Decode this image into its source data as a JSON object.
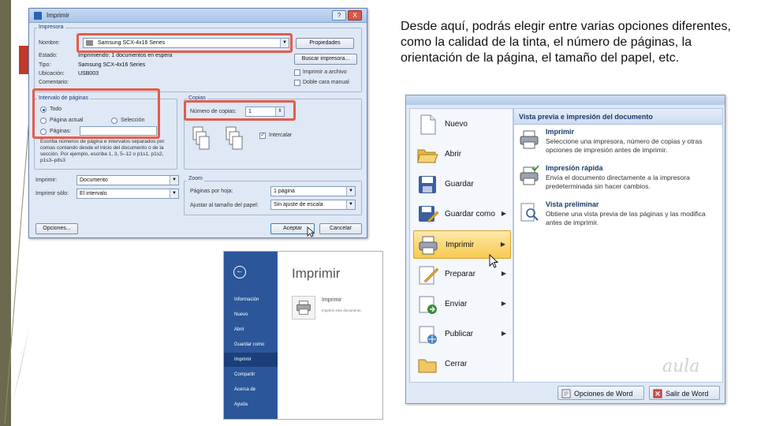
{
  "instruction_text": "Desde aquí, podrás elegir entre varias opciones diferentes, como la calidad de la tinta, el número de páginas, la orientación de la página, el tamaño del papel, etc.",
  "print_dialog": {
    "title": "Imprimir",
    "help_label": "?",
    "close_label": "X",
    "printer_group_title": "Impresora",
    "name_label": "Nombre:",
    "name_value": "Samsung SCX-4x16 Series",
    "properties_button": "Propiedades",
    "status_label": "Estado:",
    "status_value": "Imprimiendo: 1 documentos en espera",
    "find_printer_button": "Buscar impresora...",
    "type_label": "Tipo:",
    "type_value": "Samsung SCX-4x16 Series",
    "location_label": "Ubicación:",
    "location_value": "USB003",
    "comment_label": "Comentario:",
    "print_to_file_label": "Imprimir a archivo",
    "manual_duplex_label": "Doble cara manual",
    "page_range_title": "Intervalo de páginas",
    "all_label": "Todo",
    "current_page_label": "Página actual",
    "selection_label": "Selección",
    "pages_label": "Páginas:",
    "help_text": "Escriba números de página e intervalos separados por comas contando desde el inicio del documento o de la sección. Por ejemplo, escriba 1, 3, 5–12 o p1s1, p1s2, p1s3–p8s3",
    "copies_title": "Copias",
    "copies_label": "Número de copias:",
    "copies_value": "1",
    "collate_label": "Intercalar",
    "collate_checked": true,
    "print_label": "Imprimir:",
    "print_value": "Documento",
    "print_only_label": "Imprimir sólo:",
    "print_only_value": "El intervalo",
    "zoom_title": "Zoom",
    "pages_per_sheet_label": "Páginas por hoja:",
    "pages_per_sheet_value": "1 página",
    "scale_label": "Ajustar al tamaño del papel:",
    "scale_value": "Sin ajuste de escala",
    "options_button": "Opciones...",
    "ok_button": "Aceptar",
    "cancel_button": "Cancelar"
  },
  "office_menu": {
    "left_items": [
      {
        "label": "Nuevo",
        "icon": "new-document-icon",
        "has_arrow": false
      },
      {
        "label": "Abrir",
        "icon": "open-folder-icon",
        "has_arrow": false
      },
      {
        "label": "Guardar",
        "icon": "save-disk-icon",
        "has_arrow": false
      },
      {
        "label": "Guardar como",
        "icon": "save-as-icon",
        "has_arrow": true
      },
      {
        "label": "Imprimir",
        "icon": "printer-icon",
        "has_arrow": true
      },
      {
        "label": "Preparar",
        "icon": "prepare-icon",
        "has_arrow": true
      },
      {
        "label": "Enviar",
        "icon": "send-icon",
        "has_arrow": true
      },
      {
        "label": "Publicar",
        "icon": "publish-icon",
        "has_arrow": true
      },
      {
        "label": "Cerrar",
        "icon": "close-folder-icon",
        "has_arrow": false
      }
    ],
    "right_title": "Vista previa e impresión del documento",
    "right_items": [
      {
        "title": "Imprimir",
        "desc": "Seleccione una impresora, número de copias y otras opciones de impresión antes de imprimir.",
        "icon": "printer-icon"
      },
      {
        "title": "Impresión rápida",
        "desc": "Envía el documento directamente a la impresora predeterminada sin hacer cambios.",
        "icon": "quick-print-icon"
      },
      {
        "title": "Vista preliminar",
        "desc": "Obtiene una vista previa de las páginas y las modifica antes de imprimir.",
        "icon": "print-preview-icon"
      }
    ],
    "options_button": "Opciones de Word",
    "exit_button": "Salir de Word"
  },
  "backstage": {
    "back_label": "←",
    "nav_items": [
      "Información",
      "Nuevo",
      "Abrir",
      "Guardar como",
      "Imprimir",
      "Compartir",
      "Acerca de",
      "Ayuda"
    ],
    "active_item": "Imprimir",
    "title": "Imprimir",
    "card_title": "Imprimir",
    "card_desc": "Imprimir este documento."
  },
  "watermark_text": "aula",
  "colors": {
    "accent_red": "#e35c4b",
    "word_blue": "#2b579a",
    "slide_bar": "#6b6a4e",
    "highlight_gold": "#f7c94f"
  }
}
